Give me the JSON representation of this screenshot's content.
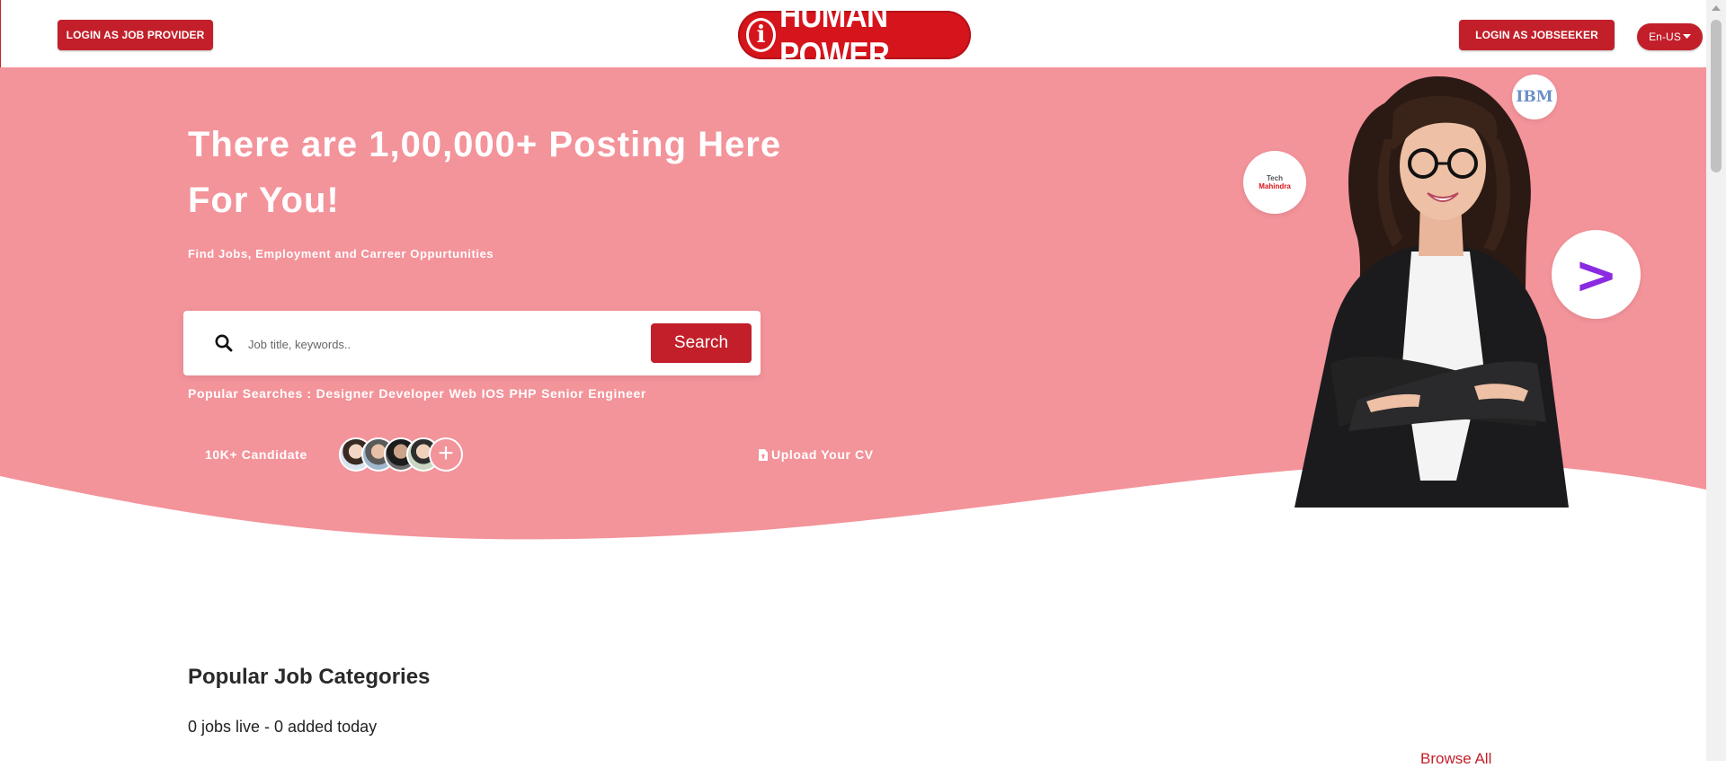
{
  "header": {
    "login_provider_label": "LOGIN AS JOB PROVIDER",
    "login_seeker_label": "LOGIN AS JOBSEEKER",
    "language_label": "En-US",
    "logo_text": "HUMAN POWER",
    "logo_icon": "i"
  },
  "hero": {
    "title": "There are 1,00,000+ Posting Here For You!",
    "subtitle": "Find Jobs, Employment and Carreer Oppurtunities",
    "search": {
      "placeholder": "Job title, keywords..",
      "button_label": "Search"
    },
    "popular_label": "Popular Searches :",
    "popular_tags": [
      "Designer",
      "Developer",
      "Web",
      "IOS",
      "PHP",
      "Senior",
      "Engineer"
    ],
    "candidates_label": "10K+ Candidate",
    "upload_cv_label": "Upload Your CV",
    "brands": {
      "ibm": "IBM",
      "tech_line1": "Tech",
      "tech_line2": "Mahindra",
      "accenture": ">"
    }
  },
  "categories": {
    "title": "Popular Job Categories",
    "stats": "0 jobs live - 0 added today",
    "browse_all": "Browse All"
  },
  "colors": {
    "brand_red": "#c21f2a",
    "hero_pink": "#f3939a",
    "accent_purple": "#8a2be2"
  }
}
